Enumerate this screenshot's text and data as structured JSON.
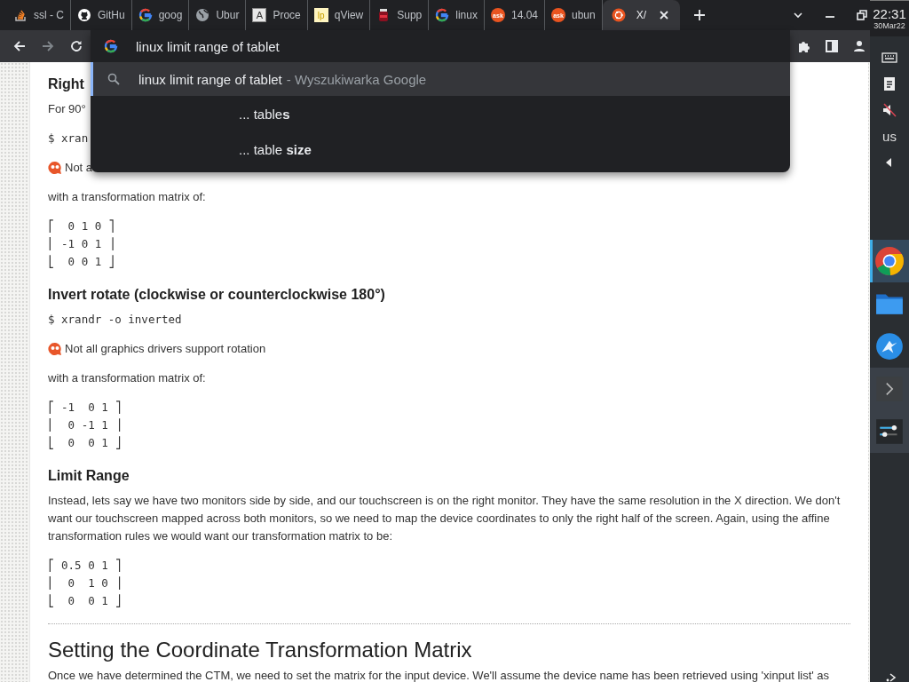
{
  "tabs": [
    {
      "label": "ssl - C",
      "kind": "stack",
      "selected": false
    },
    {
      "label": "GitHu",
      "kind": "octocat",
      "selected": false
    },
    {
      "label": "goog",
      "kind": "g",
      "selected": false
    },
    {
      "label": "Ubur",
      "kind": "globe",
      "selected": false
    },
    {
      "label": "Proce",
      "kind": "letterbox",
      "icon_label": "A",
      "selected": false
    },
    {
      "label": "qView",
      "kind": "yellowbox",
      "icon_label": "lp",
      "selected": false
    },
    {
      "label": "Supp",
      "kind": "jar",
      "selected": false
    },
    {
      "label": "linux",
      "kind": "g",
      "selected": false
    },
    {
      "label": "14.04",
      "kind": "bubble",
      "icon_label": "ask",
      "selected": false
    },
    {
      "label": "ubun",
      "kind": "bubble",
      "icon_label": "ask",
      "selected": false
    },
    {
      "label": "X/",
      "kind": "ring",
      "selected": true
    }
  ],
  "omnibox": {
    "value": "linux limit range of tablet"
  },
  "suggestions": [
    {
      "kind": "search",
      "text": "linux limit range of tablet",
      "detail": "- Wyszukiwarka Google",
      "selected": true
    },
    {
      "kind": "refine",
      "text": "... table**s**",
      "selected": false
    },
    {
      "kind": "refine",
      "text": "... table **size**",
      "selected": false
    }
  ],
  "article": [
    {
      "kind": "heading",
      "text": "Right"
    },
    {
      "kind": "text",
      "text": "For 90°"
    },
    {
      "kind": "code",
      "text": "$ xran"
    },
    {
      "kind": "note",
      "text": "Not a"
    },
    {
      "kind": "text",
      "text": "with a transformation matrix of:"
    },
    {
      "kind": "matrix",
      "lines": [
        "⎡  0 1 0 ⎤",
        "⎢ -1 0 1 ⎥",
        "⎣  0 0 1 ⎦"
      ]
    },
    {
      "kind": "heading",
      "text": "Invert rotate (clockwise or counterclockwise 180°)"
    },
    {
      "kind": "code",
      "text": "$ xrandr -o inverted"
    },
    {
      "kind": "note",
      "text": "Not all graphics drivers support rotation"
    },
    {
      "kind": "text",
      "text": "with a transformation matrix of:"
    },
    {
      "kind": "matrix",
      "lines": [
        "⎡ -1  0 1 ⎤",
        "⎢  0 -1 1 ⎥",
        "⎣  0  0 1 ⎦"
      ]
    },
    {
      "kind": "heading",
      "text": "Limit Range"
    },
    {
      "kind": "text",
      "text": "Instead, lets say we have two monitors side by side, and our touchscreen is on the right monitor. They have the same resolution in the X direction. We don't want our touchscreen mapped across both monitors, so we need to map the device coordinates to only the right half of the screen. Again, using the affine transformation rules we would want our transformation matrix to be:"
    },
    {
      "kind": "matrix",
      "lines": [
        "⎡ 0.5 0 1 ⎤",
        "⎢  0  1 0 ⎥",
        "⎣  0  0 1 ⎦"
      ]
    },
    {
      "kind": "rule"
    },
    {
      "kind": "title",
      "text": "Setting the Coordinate Transformation Matrix"
    },
    {
      "kind": "text",
      "text": "Once we have determined the CTM, we need to set the matrix for the input device. We'll assume the device name has been retrieved using 'xinput list' as"
    }
  ],
  "panel": {
    "clock": {
      "time": "22:31",
      "date": "30Mar22"
    },
    "layout": "us",
    "apps": [
      {
        "kind": "chrome",
        "active": true
      },
      {
        "kind": "folder",
        "active": false
      },
      {
        "kind": "bird",
        "active": false
      },
      {
        "kind": "terminal",
        "active": true
      },
      {
        "kind": "sliders",
        "active": true
      }
    ]
  }
}
